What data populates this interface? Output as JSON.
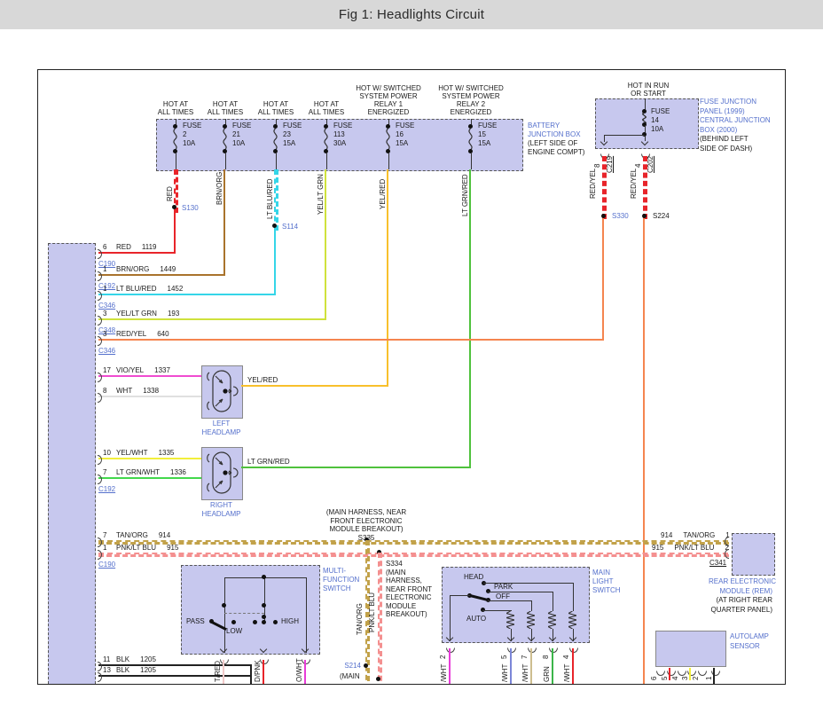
{
  "title": "Fig 1: Headlights Circuit",
  "colors": {
    "panel_fill": "#c7c8ee",
    "label_blue": "#5570cc",
    "wire_red": "#e8242a",
    "wire_brn_org": "#a9732c",
    "wire_lt_blu_red": "#35d5e8",
    "wire_yel_lt_grn": "#cfe23c",
    "wire_red_yel": "#f5854f",
    "wire_yel_red": "#f8c02c",
    "wire_lt_grn_red": "#4fc23c",
    "wire_vio_yel": "#f04cd0",
    "wire_wht": "#e0e0e0",
    "wire_yel_wht": "#f2ef3a",
    "wire_lt_grn_wht": "#42d84c",
    "wire_tan_org": "#c2a24a",
    "wire_pnk_lt_blu": "#f49090",
    "wire_blk": "#222222"
  },
  "bjb": {
    "label": [
      "BATTERY",
      "JUNCTION BOX"
    ],
    "location": [
      "(LEFT SIDE OF",
      "ENGINE COMPT)"
    ],
    "fuses": [
      {
        "hot": [
          "HOT AT",
          "ALL TIMES"
        ],
        "word": "FUSE",
        "id": "2",
        "amps": "10A"
      },
      {
        "hot": [
          "HOT AT",
          "ALL TIMES"
        ],
        "word": "FUSE",
        "id": "21",
        "amps": "10A"
      },
      {
        "hot": [
          "HOT AT",
          "ALL TIMES"
        ],
        "word": "FUSE",
        "id": "23",
        "amps": "15A"
      },
      {
        "hot": [
          "HOT AT",
          "ALL TIMES"
        ],
        "word": "FUSE",
        "id": "113",
        "amps": "30A"
      },
      {
        "hot": [
          "HOT W/ SWITCHED",
          "SYSTEM POWER",
          "RELAY 1",
          "ENERGIZED"
        ],
        "word": "FUSE",
        "id": "16",
        "amps": "15A"
      },
      {
        "hot": [
          "HOT W/ SWITCHED",
          "SYSTEM POWER",
          "RELAY 2",
          "ENERGIZED"
        ],
        "word": "FUSE",
        "id": "15",
        "amps": "15A"
      }
    ]
  },
  "fjp": {
    "hot": [
      "HOT IN RUN",
      "OR START"
    ],
    "word": "FUSE",
    "id": "14",
    "amps": "10A",
    "label": [
      "FUSE JUNCTION",
      "PANEL      (1999)",
      "CENTRAL JUNCTION",
      "BOX          (2000)"
    ],
    "location": [
      "(BEHIND LEFT",
      "SIDE OF DASH)"
    ],
    "left_pin": "8",
    "left_conn": "C219",
    "right_pin": "4",
    "right_conn": "C202"
  },
  "splices": {
    "s130": "S130",
    "s114": "S114",
    "s330": "S330",
    "s224": "S224",
    "s335": "S335",
    "s214": "S214"
  },
  "vlabels": {
    "red": "RED",
    "brn_org": "BRN/ORG",
    "lt_blu_red": "LT BLU/RED",
    "yel_lt_grn": "YEL/LT GRN",
    "yel_red": "YEL/RED",
    "lt_grn_red": "LT GRN/RED",
    "red_yel": "RED/YEL",
    "tan_org": "TAN/ORG",
    "pnk_lt_blu": "PNK/LT BLU"
  },
  "fem_rows": [
    {
      "pin": "6",
      "color": "RED",
      "circuit": "1119",
      "conn": "C190"
    },
    {
      "pin": "1",
      "color": "BRN/ORG",
      "circuit": "1449",
      "conn": "C192"
    },
    {
      "pin": "1",
      "color": "LT BLU/RED",
      "circuit": "1452",
      "conn": "C346"
    },
    {
      "pin": "3",
      "color": "YEL/LT GRN",
      "circuit": "193",
      "conn": "C348"
    },
    {
      "pin": "3",
      "color": "RED/YEL",
      "circuit": "640",
      "conn": "C346"
    },
    {
      "pin": "17",
      "color": "VIO/YEL",
      "circuit": "1337",
      "conn": ""
    },
    {
      "pin": "8",
      "color": "WHT",
      "circuit": "1338",
      "conn": ""
    },
    {
      "pin": "10",
      "color": "YEL/WHT",
      "circuit": "1335",
      "conn": ""
    },
    {
      "pin": "7",
      "color": "LT GRN/WHT",
      "circuit": "1336",
      "conn": "C192"
    },
    {
      "pin": "7",
      "color": "TAN/ORG",
      "circuit": "914",
      "conn": ""
    },
    {
      "pin": "1",
      "color": "PNK/LT BLU",
      "circuit": "915",
      "conn": "C190"
    },
    {
      "pin": "11",
      "color": "BLK",
      "circuit": "1205",
      "conn": ""
    },
    {
      "pin": "13",
      "color": "BLK",
      "circuit": "1205",
      "conn": ""
    }
  ],
  "headlamps": {
    "left_label": [
      "LEFT",
      "HEADLAMP"
    ],
    "right_label": [
      "RIGHT",
      "HEADLAMP"
    ],
    "left_out": "YEL/RED",
    "right_out": "LT GRN/RED"
  },
  "notes": {
    "s335": [
      "(MAIN HARNESS, NEAR",
      "FRONT ELECTRONIC",
      "MODULE BREAKOUT)",
      "S335"
    ],
    "s334": [
      "S334",
      "(MAIN",
      "HARNESS,",
      "NEAR FRONT",
      "ELECTRONIC",
      "MODULE",
      "BREAKOUT)"
    ],
    "s214_extra": "(MAIN"
  },
  "mfs": {
    "label": [
      "MULTI-",
      "FUNCTION",
      "SWITCH"
    ],
    "pass": "PASS",
    "low": "LOW",
    "high": "HIGH",
    "fragments": [
      "T/RED",
      "D/PNK",
      "O/WHT"
    ]
  },
  "mls": {
    "label": [
      "MAIN",
      "LIGHT",
      "SWITCH"
    ],
    "head": "HEAD",
    "park": "PARK",
    "off": "OFF",
    "auto": "AUTO",
    "pins": [
      "2",
      "5",
      "7",
      "8",
      "4"
    ],
    "fragments": [
      "/WHT",
      "/WHT",
      "/WHT",
      "GRN",
      "/WHT"
    ]
  },
  "rem": {
    "rows": [
      {
        "circuit": "914",
        "color": "TAN/ORG",
        "pin": "1"
      },
      {
        "circuit": "915",
        "color": "PNK/LT BLU",
        "pin": "2"
      }
    ],
    "conn": "C341",
    "label": [
      "REAR ELECTRONIC",
      "MODULE (REM)"
    ],
    "location": [
      "(AT RIGHT REAR",
      "QUARTER PANEL)"
    ]
  },
  "autolamp": {
    "label": [
      "AUTOLAMP",
      "SENSOR"
    ],
    "pins": [
      "6",
      "5",
      "4",
      "3",
      "2",
      "1"
    ]
  }
}
